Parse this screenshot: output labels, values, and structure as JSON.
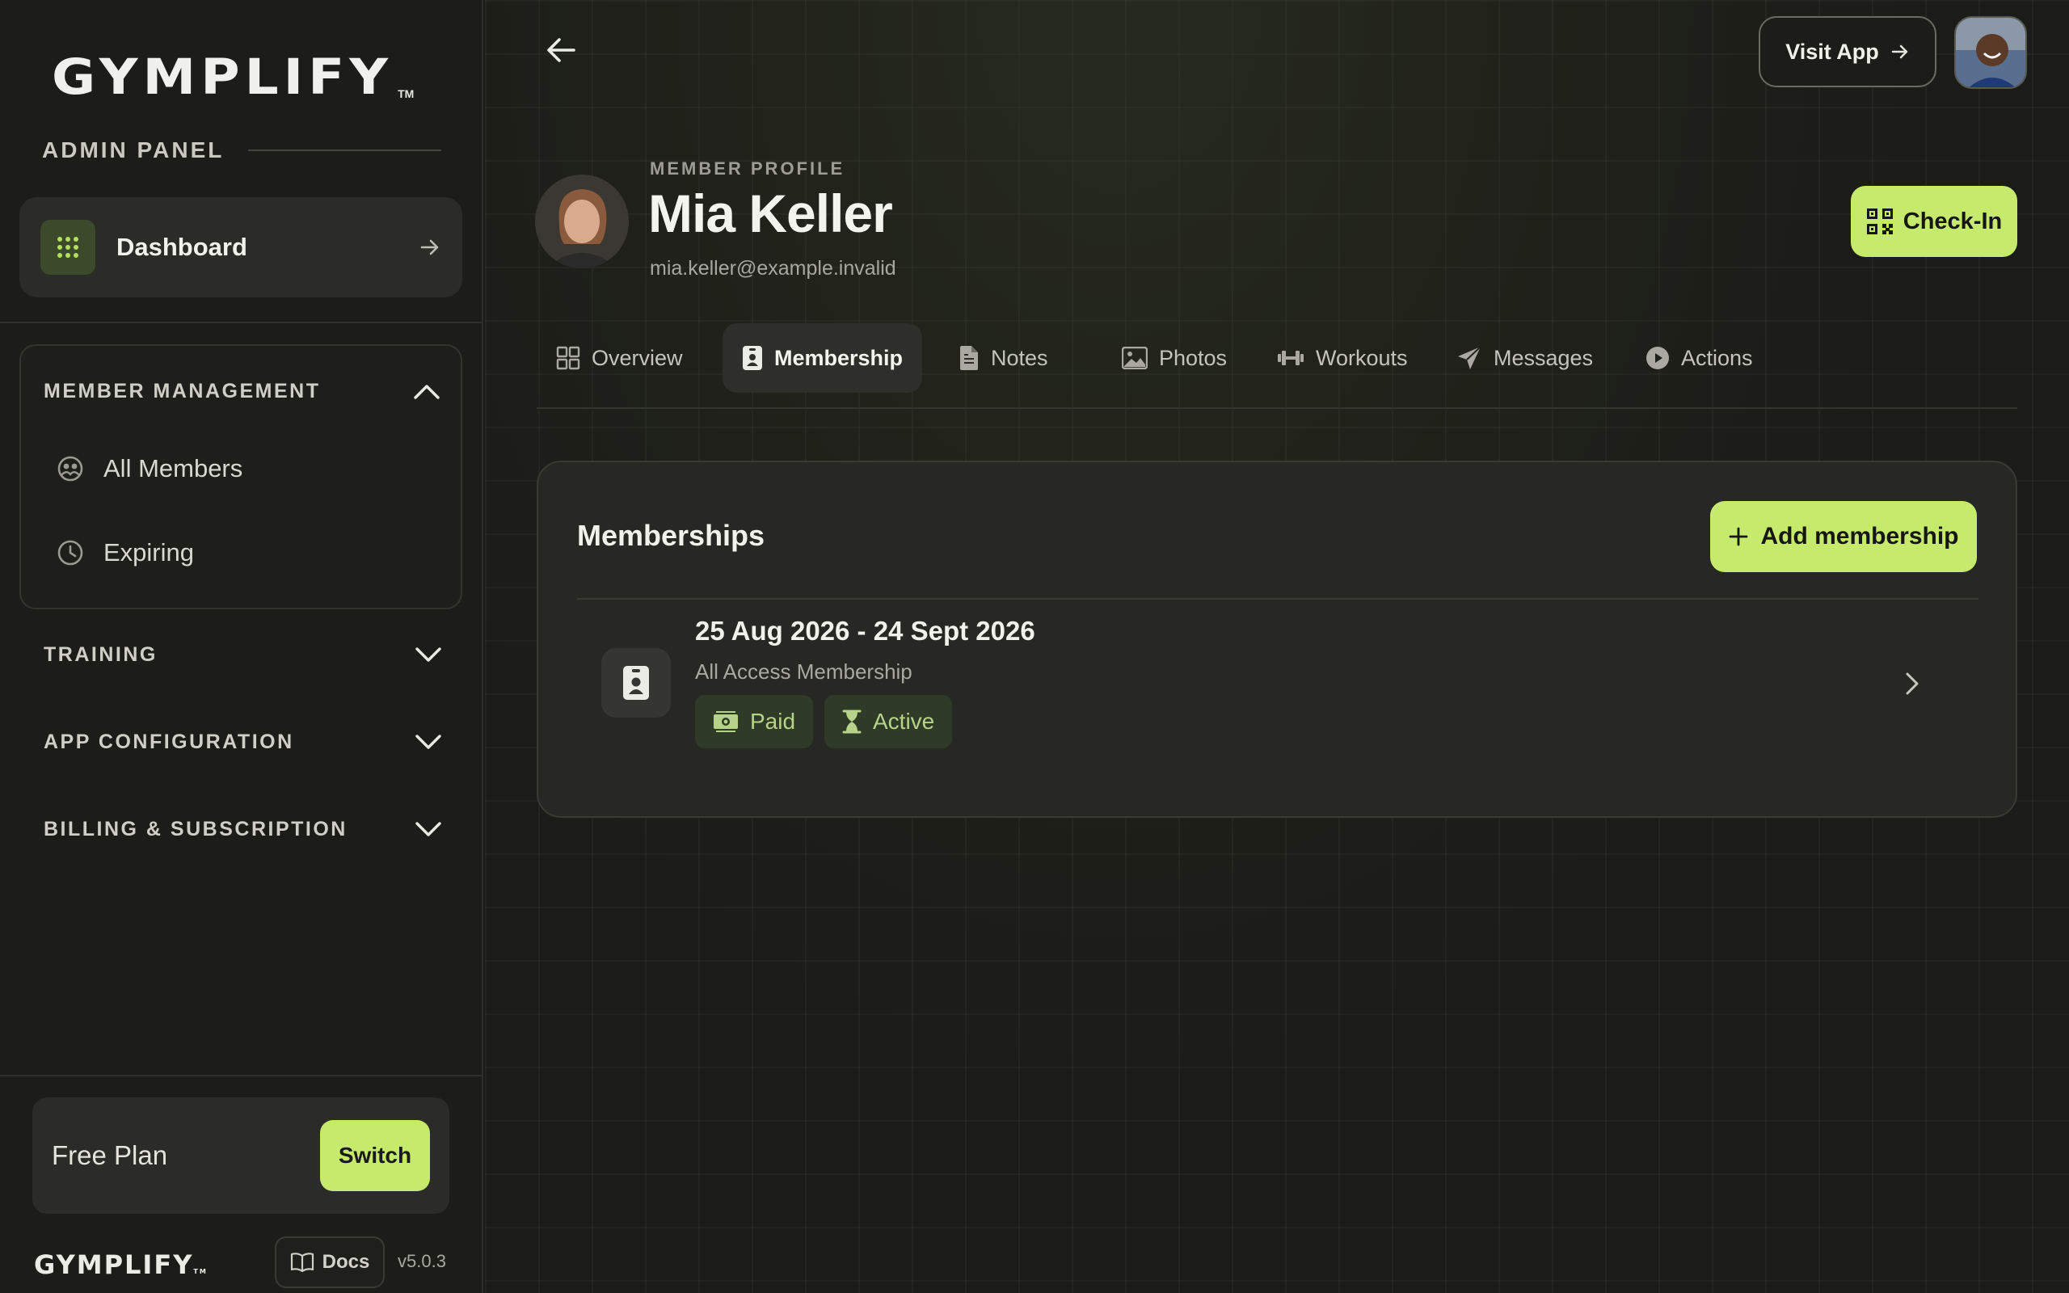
{
  "sidebar": {
    "logo": "GYMPLIFY",
    "logo_tm": "TM",
    "admin_label": "ADMIN PANEL",
    "dashboard_label": "Dashboard",
    "member_management": {
      "title": "MEMBER MANAGEMENT",
      "items": [
        {
          "label": "All Members",
          "icon": "users-icon"
        },
        {
          "label": "Expiring",
          "icon": "clock-icon"
        }
      ]
    },
    "sections": [
      {
        "title": "TRAINING"
      },
      {
        "title": "APP CONFIGURATION"
      },
      {
        "title": "BILLING & SUBSCRIPTION"
      }
    ],
    "plan": {
      "label": "Free Plan",
      "switch_label": "Switch"
    },
    "footer": {
      "logo": "GYMPLIFY",
      "logo_tm": "TM",
      "docs_label": "Docs",
      "version": "v5.0.3"
    }
  },
  "header": {
    "visit_app_label": "Visit App"
  },
  "profile": {
    "eyebrow": "MEMBER PROFILE",
    "name": "Mia Keller",
    "email": "mia.keller@example.invalid",
    "checkin_label": "Check-In"
  },
  "tabs": [
    {
      "label": "Overview",
      "icon": "grid-icon",
      "active": false
    },
    {
      "label": "Membership",
      "icon": "id-badge-icon",
      "active": true
    },
    {
      "label": "Notes",
      "icon": "document-icon",
      "active": false
    },
    {
      "label": "Photos",
      "icon": "image-icon",
      "active": false
    },
    {
      "label": "Workouts",
      "icon": "dumbbell-icon",
      "active": false
    },
    {
      "label": "Messages",
      "icon": "send-icon",
      "active": false
    },
    {
      "label": "Actions",
      "icon": "play-circle-icon",
      "active": false
    }
  ],
  "memberships": {
    "title": "Memberships",
    "add_label": "Add membership",
    "items": [
      {
        "dates": "25 Aug 2026 - 24 Sept 2026",
        "type": "All Access Membership",
        "payment_status": "Paid",
        "status": "Active"
      }
    ]
  },
  "colors": {
    "accent": "#c5ea6c",
    "background": "#1b1b18",
    "card": "#272724",
    "badge_bg": "#2f3b26",
    "badge_text": "#b6d389"
  }
}
